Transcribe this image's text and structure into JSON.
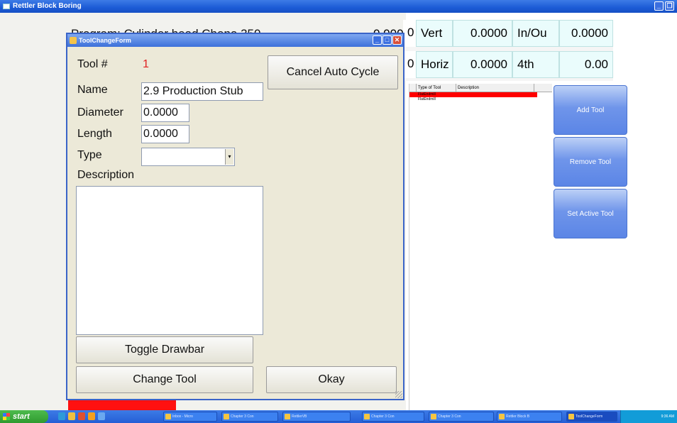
{
  "main_window": {
    "title": "Rettler Block Boring"
  },
  "behind_dialog": {
    "program_text": "Program: Cylinder head Cheno 350",
    "value_text": "0.000"
  },
  "dro": {
    "vert_label": "Vert",
    "vert_value": "0.0000",
    "inout_label": "In/Ou",
    "inout_value": "0.0000",
    "horiz_label": "Horiz",
    "horiz_value": "0.0000",
    "fourth_label": "4th",
    "fourth_value": "0.00",
    "left_stub_1": "0",
    "left_stub_2": "0"
  },
  "tool_table": {
    "columns": [
      "Type of Tool",
      "Description"
    ],
    "rows": [
      {
        "type": "FlatEndmill",
        "selected": true
      },
      {
        "type": "FlatEndmill",
        "selected": false
      }
    ]
  },
  "side_buttons": {
    "add": "Add Tool",
    "remove": "Remove Tool",
    "set_active": "Set Active Tool"
  },
  "dialog": {
    "title": "ToolChangeForm",
    "tool_label": "Tool #",
    "tool_number": "1",
    "name_label": "Name",
    "name_value": "2.9 Production Stub",
    "diameter_label": "Diameter",
    "diameter_value": "0.0000",
    "length_label": "Length",
    "length_value": "0.0000",
    "type_label": "Type",
    "type_value": "",
    "description_label": "Description",
    "description_value": "",
    "cancel_auto_cycle": "Cancel Auto Cycle",
    "toggle_drawbar": "Toggle Drawbar",
    "change_tool": "Change Tool",
    "okay": "Okay",
    "colors": {
      "tool_number": "#e02020"
    }
  },
  "taskbar": {
    "start": "start",
    "items": [
      "Inbox - Micro",
      "Chapter 3 Con",
      "RettlerVB",
      "Chapter 3 Con",
      "Chapter 3 Con",
      "Rettler Block B",
      "ToolChangeForm"
    ],
    "clock": "9:36 AM"
  }
}
